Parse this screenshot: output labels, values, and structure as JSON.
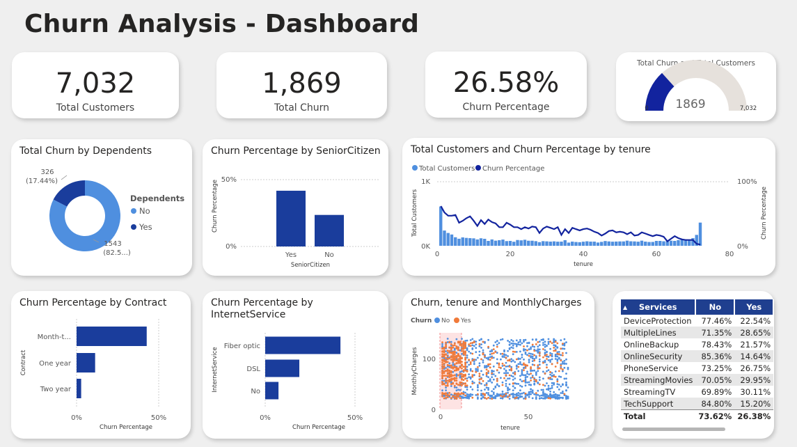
{
  "title": "Churn Analysis - Dashboard",
  "kpis": {
    "total_customers": {
      "value": "7,032",
      "label": "Total Customers"
    },
    "total_churn": {
      "value": "1,869",
      "label": "Total Churn"
    },
    "churn_pct": {
      "value": "26.58%",
      "label": "Churn Percentage"
    }
  },
  "gauge": {
    "title": "Total Churn and Total Customers",
    "value": "1869",
    "min": "0",
    "max": "7,032",
    "fraction": 0.2658
  },
  "dependents": {
    "title": "Total Churn by Dependents",
    "legend_title": "Dependents",
    "legend": [
      "No",
      "Yes"
    ],
    "label_yes": "326",
    "label_yes_pct": "(17.44%)",
    "label_no": "1543",
    "label_no_pct": "(82.5...)"
  },
  "senior": {
    "title": "Churn Percentage by SeniorCitizen",
    "ylabel": "Churn Percentage",
    "xlabel": "SeniorCitizen",
    "ytick_top": "50%",
    "ytick_zero": "0%"
  },
  "tenure": {
    "title": "Total Customers and Churn Percentage by tenure",
    "legend": [
      "Total Customers",
      "Churn Percentage"
    ],
    "ylabel_left": "Total Customers",
    "ylabel_right": "Churn Percentage",
    "xlabel": "tenure",
    "yl_top": "1K",
    "yl_zero": "0K",
    "yr_top": "100%",
    "yr_zero": "0%",
    "xticks": [
      "0",
      "20",
      "40",
      "60",
      "80"
    ]
  },
  "contract": {
    "title": "Churn Percentage by Contract",
    "ylabel": "Contract",
    "xlabel": "Churn Percentage",
    "xticks": [
      "0%",
      "50%"
    ]
  },
  "internet": {
    "title_line1": "Churn Percentage by",
    "title_line2": "InternetService",
    "ylabel": "InternetService",
    "xlabel": "Churn Percentage",
    "xticks": [
      "0%",
      "50%"
    ]
  },
  "scatter": {
    "title": "Churn, tenure and MonthlyCharges",
    "legend_title": "Churn",
    "legend": [
      "No",
      "Yes"
    ],
    "ylabel": "MonthlyCharges",
    "xlabel": "tenure",
    "yticks": [
      "0",
      "100"
    ],
    "xticks": [
      "0",
      "50"
    ]
  },
  "services": {
    "headers": [
      "Services",
      "No",
      "Yes"
    ],
    "rows": [
      [
        "DeviceProtection",
        "77.46%",
        "22.54%"
      ],
      [
        "MultipleLines",
        "71.35%",
        "28.65%"
      ],
      [
        "OnlineBackup",
        "78.43%",
        "21.57%"
      ],
      [
        "OnlineSecurity",
        "85.36%",
        "14.64%"
      ],
      [
        "PhoneService",
        "73.25%",
        "26.75%"
      ],
      [
        "StreamingMovies",
        "70.05%",
        "29.95%"
      ],
      [
        "StreamingTV",
        "69.89%",
        "30.11%"
      ],
      [
        "TechSupport",
        "84.80%",
        "15.20%"
      ]
    ],
    "total": [
      "Total",
      "73.62%",
      "26.38%"
    ]
  },
  "colors": {
    "dark_blue": "#1a3d9c",
    "light_blue": "#4f8fdf",
    "orange": "#f07a3a",
    "gauge_bg": "#e6e1dc",
    "line": "#12239e"
  },
  "chart_data": [
    {
      "type": "pie",
      "title": "Total Churn by Dependents",
      "categories": [
        "No",
        "Yes"
      ],
      "values": [
        1543,
        326
      ]
    },
    {
      "type": "bar",
      "title": "Churn Percentage by SeniorCitizen",
      "categories": [
        "Yes",
        "No"
      ],
      "values": [
        41.7,
        23.6
      ],
      "ylim": [
        0,
        50
      ],
      "xlabel": "SeniorCitizen",
      "ylabel": "Churn Percentage"
    },
    {
      "type": "bar",
      "title": "Churn Percentage by Contract",
      "categories": [
        "Month-t...",
        "One year",
        "Two year"
      ],
      "values": [
        42.7,
        11.3,
        2.8
      ],
      "xlim": [
        0,
        50
      ],
      "xlabel": "Churn Percentage",
      "ylabel": "Contract"
    },
    {
      "type": "bar",
      "title": "Churn Percentage by InternetService",
      "categories": [
        "Fiber optic",
        "DSL",
        "No"
      ],
      "values": [
        41.9,
        19.0,
        7.4
      ],
      "xlim": [
        0,
        50
      ],
      "xlabel": "Churn Percentage",
      "ylabel": "InternetService"
    },
    {
      "type": "line",
      "title": "Total Customers and Churn Percentage by tenure",
      "xlabel": "tenure",
      "xlim": [
        0,
        80
      ],
      "x": [
        1,
        2,
        3,
        4,
        5,
        6,
        7,
        8,
        9,
        10,
        11,
        12,
        13,
        14,
        15,
        16,
        17,
        18,
        19,
        20,
        21,
        22,
        23,
        24,
        25,
        26,
        27,
        28,
        29,
        30,
        31,
        32,
        33,
        34,
        35,
        36,
        37,
        38,
        39,
        40,
        41,
        42,
        43,
        44,
        45,
        46,
        47,
        48,
        49,
        50,
        51,
        52,
        53,
        54,
        55,
        56,
        57,
        58,
        59,
        60,
        61,
        62,
        63,
        64,
        65,
        66,
        67,
        68,
        69,
        70,
        71,
        72
      ],
      "series": [
        {
          "name": "Total Customers",
          "axis": "left",
          "ylim": [
            0,
            1000
          ],
          "values": [
            613,
            238,
            200,
            176,
            133,
            110,
            131,
            123,
            119,
            116,
            99,
            117,
            109,
            76,
            99,
            80,
            87,
            97,
            73,
            76,
            63,
            90,
            85,
            94,
            79,
            79,
            72,
            57,
            72,
            69,
            65,
            69,
            64,
            65,
            88,
            50,
            65,
            59,
            56,
            64,
            70,
            65,
            65,
            51,
            61,
            74,
            68,
            64,
            66,
            68,
            68,
            80,
            70,
            68,
            64,
            80,
            65,
            59,
            60,
            76,
            76,
            70,
            72,
            80,
            76,
            89,
            98,
            100,
            95,
            119,
            170,
            362
          ]
        },
        {
          "name": "Churn Percentage",
          "axis": "right",
          "ylim": [
            0,
            100
          ],
          "values": [
            62,
            52,
            47,
            47,
            48,
            36,
            39,
            43,
            46,
            39,
            31,
            40,
            34,
            41,
            37,
            35,
            29,
            29,
            36,
            33,
            29,
            29,
            26,
            29,
            27,
            30,
            29,
            20,
            27,
            30,
            28,
            26,
            29,
            17,
            26,
            20,
            28,
            26,
            24,
            26,
            27,
            25,
            22,
            20,
            16,
            19,
            23,
            24,
            21,
            22,
            21,
            18,
            21,
            16,
            17,
            21,
            19,
            17,
            15,
            17,
            16,
            14,
            7,
            11,
            15,
            12,
            10,
            9,
            9,
            9,
            3,
            2
          ]
        }
      ]
    },
    {
      "type": "scatter",
      "title": "Churn, tenure and MonthlyCharges",
      "xlabel": "tenure",
      "ylabel": "MonthlyCharges",
      "xlim": [
        0,
        72
      ],
      "ylim": [
        0,
        130
      ],
      "series": [
        {
          "name": "No",
          "color": "#4f8fdf"
        },
        {
          "name": "Yes",
          "color": "#f07a3a"
        }
      ]
    }
  ]
}
